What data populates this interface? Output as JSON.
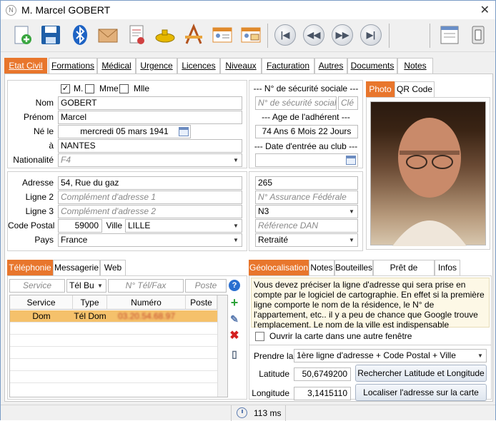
{
  "window": {
    "title": "M.  Marcel GOBERT",
    "app_icon": "app-logo-icon",
    "close": "✕"
  },
  "toolbar": {
    "icons": [
      "add-record-icon",
      "save-icon",
      "bluetooth-icon",
      "mail-envelope-icon",
      "print-document-icon",
      "submarine-icon",
      "drawing-tools-icon",
      "contact-card-icon",
      "contact-card-mail-icon"
    ],
    "nav": [
      "first-record-icon",
      "previous-record-icon",
      "next-record-icon",
      "last-record-icon"
    ],
    "right": [
      "window-layout-icon",
      "toggle-switch-icon"
    ]
  },
  "tabs": [
    "Etat Civil",
    "Formations",
    "Médical",
    "Urgence",
    "Licences",
    "Niveaux",
    "Facturation",
    "Autres",
    "Documents",
    "Notes"
  ],
  "civil": {
    "civility": {
      "m": "M.",
      "mme": "Mme",
      "mlle": "Mlle",
      "m_checked": "✓"
    },
    "labels": {
      "nom": "Nom",
      "prenom": "Prénom",
      "ne_le": "Né le",
      "a": "à",
      "nationalite": "Nationalité"
    },
    "nom": "GOBERT",
    "prenom": "Marcel",
    "birth_date": "mercredi 05 mars 1941",
    "birth_place": "NANTES",
    "nationality": "F4"
  },
  "secu": {
    "title": "--- N° de sécurité sociale ---",
    "number_placeholder": "N° de sécurité sociale",
    "key_placeholder": "Clé",
    "age_title": "--- Age de l'adhérent ---",
    "age": "74 Ans 6 Mois 22 Jours",
    "entry_title": "--- Date d'entrée au club ---"
  },
  "photo_tabs": [
    "Photo",
    "QR Code"
  ],
  "address": {
    "labels": {
      "adresse": "Adresse",
      "ligne2": "Ligne 2",
      "ligne3": "Ligne 3",
      "cp": "Code Postal",
      "ville": "Ville",
      "pays": "Pays"
    },
    "adresse": "54, Rue du gaz",
    "ligne2_placeholder": "Complément d'adresse 1",
    "ligne3_placeholder": "Complément d'adresse 2",
    "code_postal": "59000",
    "ville": "LILLE",
    "pays": "France"
  },
  "federal": {
    "number": "265",
    "assurance_placeholder": "N° Assurance Fédérale",
    "level": "N3",
    "dan_placeholder": "Référence DAN",
    "status": "Retraité"
  },
  "phone_tabs": [
    "Téléphonie",
    "Messagerie",
    "Web"
  ],
  "phone": {
    "service_placeholder": "Service",
    "type_value": "Tél Bur",
    "number_placeholder": "N° Tél/Fax",
    "poste_placeholder": "Poste",
    "columns": [
      "Service",
      "Type",
      "Numéro",
      "Poste"
    ],
    "rows": [
      {
        "service": "Dom",
        "type": "Tél Dom",
        "numero": "03.20.54.68.97",
        "poste": ""
      }
    ],
    "side_icons": [
      "help-icon",
      "add-icon",
      "edit-icon",
      "delete-icon",
      "phone-icon"
    ]
  },
  "geo_tabs": [
    "Géolocalisation",
    "Notes",
    "Bouteilles",
    "Prêt de matériel",
    "Infos"
  ],
  "geo": {
    "info": "Vous devez préciser la ligne d'adresse qui sera prise en compte par le logiciel de cartographie. En effet si la première ligne comporte le nom de la résidence, le N° de l'appartement, etc.. il y a peu de chance que Google trouve l'emplacement. Le nom de la ville est indispensable",
    "open_window": "Ouvrir la carte dans une autre fenêtre",
    "prendre_label": "Prendre la",
    "prendre_value": "1ère ligne d'adresse + Code Postal + Ville",
    "latitude_label": "Latitude",
    "latitude": "50,6749200",
    "longitude_label": "Longitude",
    "longitude": "3,1415110",
    "search_button": "Rechercher Latitude et Longitude",
    "locate_button": "Localiser l'adresse sur la carte"
  },
  "status": {
    "time": "113 ms",
    "icon": "clock-icon"
  },
  "colors": {
    "accent": "#e8762c",
    "selected_row": "#f5c16b"
  }
}
